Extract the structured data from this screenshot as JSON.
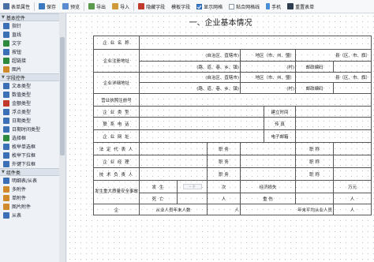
{
  "toolbar": {
    "items": [
      {
        "label": "表单属性",
        "icon": "form-props-icon",
        "color": "#4a6fa5"
      },
      {
        "label": "保存",
        "icon": "save-icon",
        "color": "#3a78c2"
      },
      {
        "label": "预览",
        "icon": "preview-icon",
        "color": "#5b8bd0"
      },
      {
        "label": "导出",
        "icon": "export-icon",
        "color": "#5a9a4e"
      },
      {
        "label": "导入",
        "icon": "import-icon",
        "color": "#d09a3a"
      },
      {
        "label": "隐藏字段",
        "icon": "hidden-field-icon",
        "color": "#c0392b"
      },
      {
        "label": "模板字段",
        "icon": "template-field-icon",
        "color": "#7f8c8d"
      },
      {
        "label": "显示网格",
        "icon": "show-grid-checkbox",
        "checked": true
      },
      {
        "label": "粘合网格线",
        "icon": "snap-grid-checkbox",
        "checked": false
      },
      {
        "label": "手机",
        "icon": "mobile-icon",
        "color": "#4a90d9"
      },
      {
        "label": "重置表单",
        "icon": "reset-form-icon",
        "color": "#2c3e50"
      }
    ]
  },
  "sidebar": {
    "groups": [
      {
        "label": "基本控件",
        "items": [
          {
            "label": "指针",
            "icon": "pointer-icon",
            "color": "#3b6fb6"
          },
          {
            "label": "直线",
            "icon": "line-icon",
            "color": "#3b6fb6"
          },
          {
            "label": "文字",
            "icon": "text-icon",
            "color": "#2b8a3e"
          },
          {
            "label": "按钮",
            "icon": "button-icon",
            "color": "#3b6fb6"
          },
          {
            "label": "超链接",
            "icon": "hyperlink-icon",
            "color": "#2b8a3e"
          },
          {
            "label": "图片",
            "icon": "image-icon",
            "color": "#d08a2a"
          }
        ]
      },
      {
        "label": "字段控件",
        "items": [
          {
            "label": "文本类型",
            "icon": "text-type-icon",
            "color": "#3b6fb6"
          },
          {
            "label": "数值类型",
            "icon": "number-type-icon",
            "color": "#3b6fb6"
          },
          {
            "label": "金额类型",
            "icon": "money-type-icon",
            "color": "#c0392b"
          },
          {
            "label": "浮点类型",
            "icon": "float-type-icon",
            "color": "#3b6fb6"
          },
          {
            "label": "日期类型",
            "icon": "date-type-icon",
            "color": "#3b6fb6"
          },
          {
            "label": "日期时间类型",
            "icon": "datetime-type-icon",
            "color": "#3b6fb6"
          },
          {
            "label": "选择框",
            "icon": "checkbox-icon",
            "color": "#2b8a3e"
          },
          {
            "label": "枚举单选框",
            "icon": "enum-radio-icon",
            "color": "#3b6fb6"
          },
          {
            "label": "枚举下拉框",
            "icon": "enum-dropdown-icon",
            "color": "#3b6fb6"
          },
          {
            "label": "外键下拉框",
            "icon": "fk-dropdown-icon",
            "color": "#3b6fb6"
          }
        ]
      },
      {
        "label": "组件类",
        "items": [
          {
            "label": "明细表/从表",
            "icon": "detail-table-icon",
            "color": "#3b6fb6"
          },
          {
            "label": "多附件",
            "icon": "multi-attachment-icon",
            "color": "#d08a2a"
          },
          {
            "label": "单附件",
            "icon": "single-attachment-icon",
            "color": "#d08a2a"
          },
          {
            "label": "图片附件",
            "icon": "image-attachment-icon",
            "color": "#d08a2a"
          },
          {
            "label": "从表",
            "icon": "subtable-icon",
            "color": "#3b6fb6"
          }
        ]
      }
    ]
  },
  "form": {
    "title": "一、企业基本情况",
    "company_name": "企 业 名 称",
    "reg_address": "企业注册地址",
    "detail_address": "企业详细地址",
    "region": "(自治区、直辖市)",
    "city": "地区（市、州、盟）",
    "county": "县（区、市、旗）",
    "town": "(路、道、巷、乡、镇)",
    "village": "(村)",
    "postcode": "邮政编码",
    "license_no": "营业执照注册号",
    "company_type": "企 业 类 型",
    "founded": "建立时间",
    "phone": "联 系 电 话",
    "fax": "传    真",
    "website": "企 业 网 址",
    "email": "电子邮箱",
    "legal_rep": "法 定 代 表 人",
    "manager": "企 业 经 理",
    "tech_lead": "技 术 负 责 人",
    "position": "职    务",
    "title_pos": "职    称",
    "accident": "发生重大质量安全事故",
    "occurred": "发    生",
    "times": "次",
    "econ_loss": "经济损失",
    "wan_yuan": "万元",
    "deaths": "死    亡",
    "people": "人",
    "injured": "重    伤",
    "company_short": "企",
    "annual_staff": "从业人员年末人数",
    "avg_staff": "年末平均从业人员",
    "small_mark": "~ 不"
  }
}
